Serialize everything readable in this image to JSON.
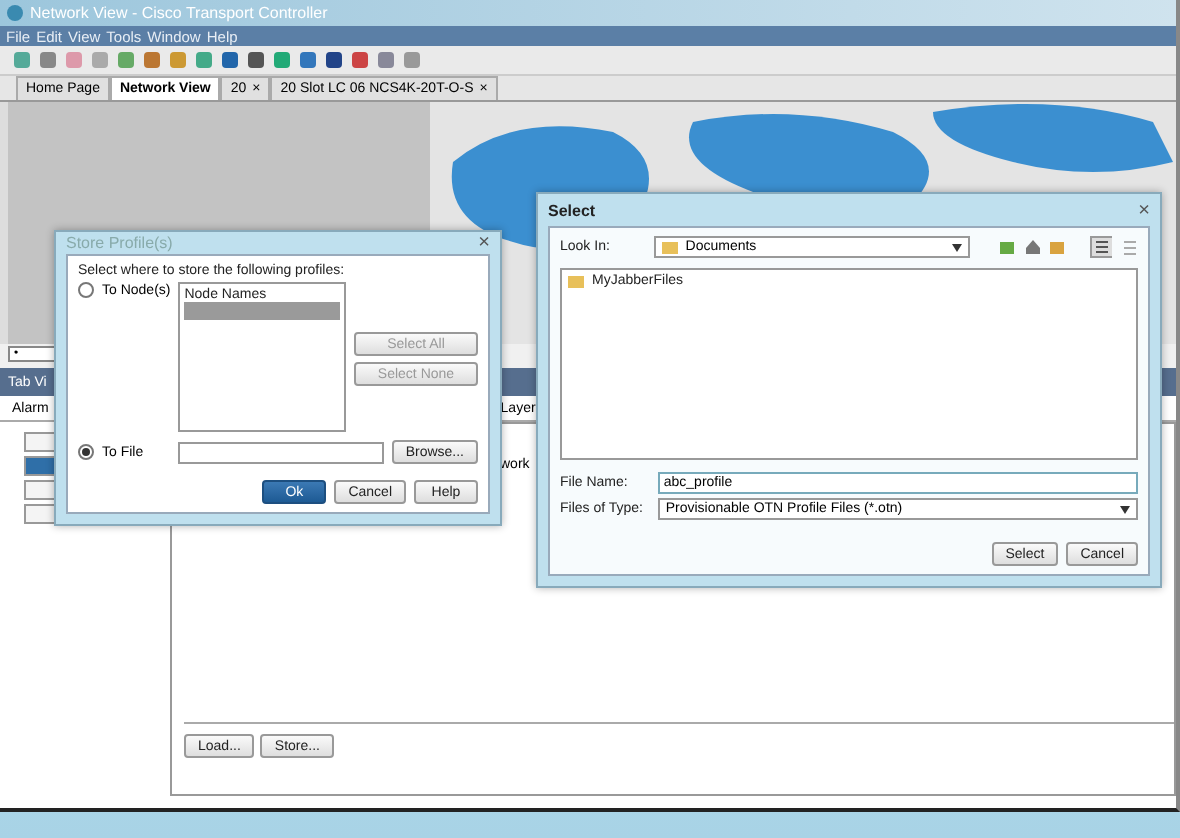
{
  "window": {
    "title": "Network View - Cisco Transport Controller"
  },
  "menu": [
    "File",
    "Edit",
    "View",
    "Tools",
    "Window",
    "Help"
  ],
  "tabs": [
    {
      "label": "Home Page",
      "selected": false,
      "closable": false
    },
    {
      "label": "Network View",
      "selected": true,
      "closable": false
    },
    {
      "label": "20",
      "selected": false,
      "closable": true
    },
    {
      "label": "20 Slot LC 06 NCS4K-20T-O-S",
      "selected": false,
      "closable": true
    }
  ],
  "close_glyph": "×",
  "filter_field": {
    "value": "•"
  },
  "tab_view": {
    "title": "Tab Vi",
    "tabs": [
      "Alarm",
      "Layer"
    ],
    "side_buttons": [
      {
        "selected": false
      },
      {
        "selected": true
      },
      {
        "selected": false
      },
      {
        "selected": false
      }
    ],
    "column": "work",
    "buttons": [
      "Load...",
      "Store..."
    ]
  },
  "store_dialog": {
    "title": "Store Profile(s)",
    "close": "×",
    "prompt": "Select where to store the following profiles:",
    "options": [
      {
        "label": "To Node(s)",
        "selected": false
      },
      {
        "label": "To File",
        "selected": true
      }
    ],
    "node_list": {
      "title": "Node Names",
      "rows": [
        {
          "selected": true
        }
      ]
    },
    "side_buttons": [
      {
        "label": "Select All",
        "disabled": true
      },
      {
        "label": "Select None",
        "disabled": true
      }
    ],
    "browse": "Browse...",
    "buttons": [
      {
        "label": "Ok",
        "kind": "primary"
      },
      {
        "label": "Cancel",
        "kind": "normal"
      },
      {
        "label": "Help",
        "kind": "normal"
      }
    ]
  },
  "select_dialog": {
    "title": "Select",
    "close": "×",
    "look_in_label": "Look In:",
    "look_in": "Documents",
    "files": [
      "MyJabberFiles"
    ],
    "file_name_label": "File Name:",
    "file_name": "abc_profile",
    "type_label": "Files of Type:",
    "type": "Provisionable OTN Profile Files (*.otn)",
    "buttons": [
      "Select",
      "Cancel"
    ]
  }
}
